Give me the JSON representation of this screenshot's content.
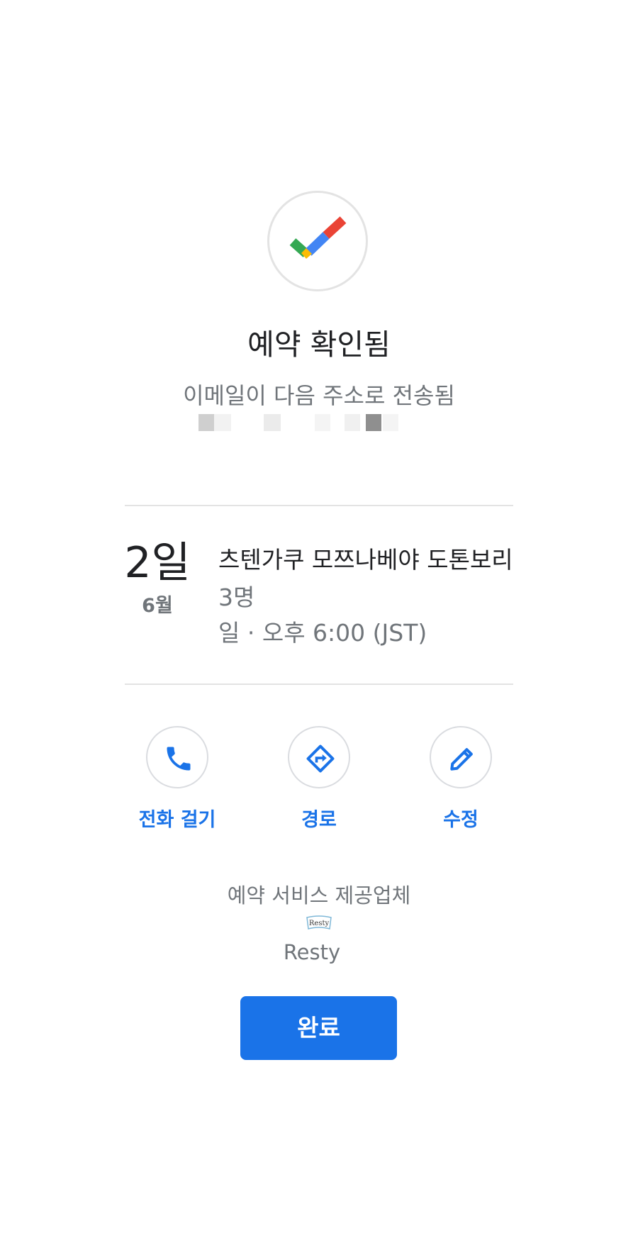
{
  "confirmation": {
    "title": "예약 확인됨",
    "subtitle": "이메일이 다음 주소로 전송됨",
    "check_icon": "google-check-icon"
  },
  "reservation": {
    "day": "2일",
    "month": "6월",
    "restaurant": "츠텐가쿠 모쯔나베야 도톤보리",
    "party_size": "3명",
    "time": "일 · 오후 6:00 (JST)"
  },
  "actions": [
    {
      "label": "전화 걸기",
      "icon": "phone-icon"
    },
    {
      "label": "경로",
      "icon": "directions-icon"
    },
    {
      "label": "수정",
      "icon": "edit-icon"
    }
  ],
  "provider": {
    "caption": "예약 서비스 제공업체",
    "logo_text": "Resty",
    "name": "Resty"
  },
  "done_button": {
    "label": "완료"
  },
  "colors": {
    "accent": "#1a73e8",
    "google_green": "#34a853",
    "google_blue": "#4285f4",
    "google_red": "#ea4335",
    "google_yellow": "#fbbc04"
  }
}
